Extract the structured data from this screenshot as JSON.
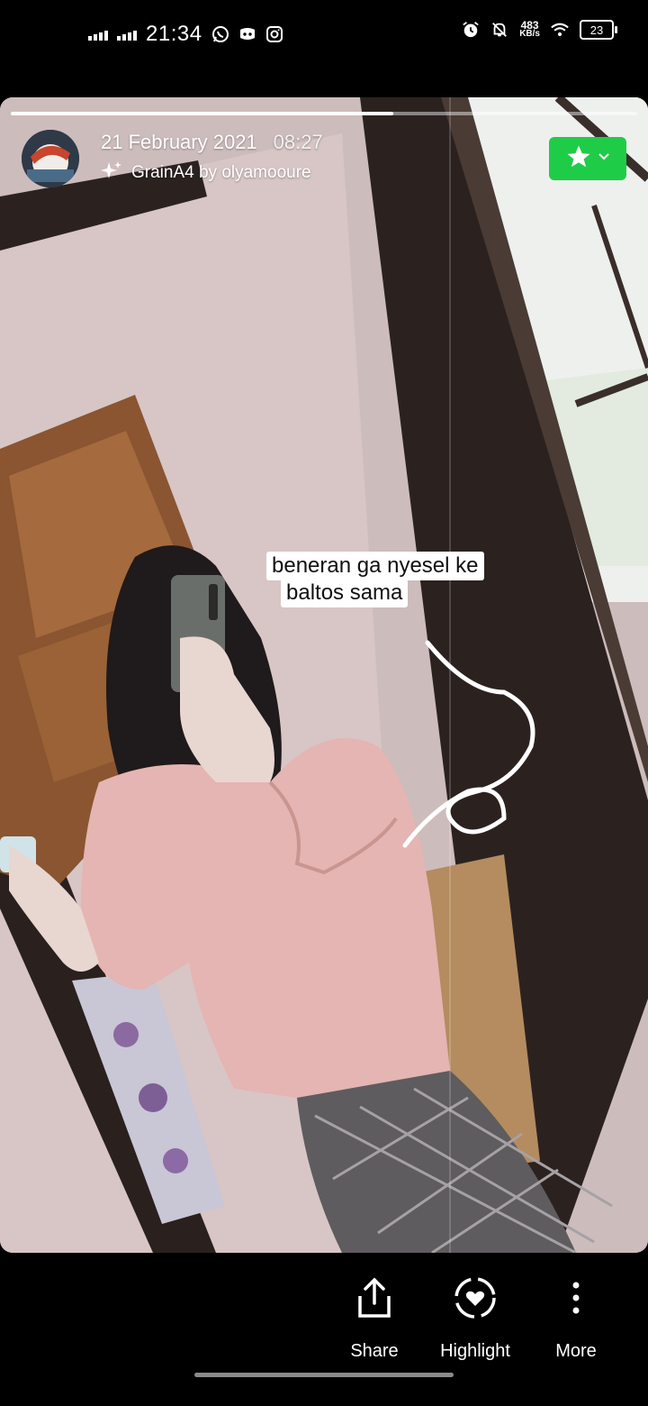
{
  "status_bar": {
    "time": "21:34",
    "net_speed_value": "483",
    "net_speed_unit": "KB/s",
    "battery": "23",
    "icons": [
      "signal-icon",
      "whatsapp-icon",
      "discord-icon",
      "instagram-icon",
      "alarm-icon",
      "mute-icon",
      "wifi-icon",
      "battery-icon"
    ]
  },
  "story": {
    "progress": 0.61,
    "date": "21 February 2021",
    "time": "08:27",
    "filter_credit": "GrainA4 by olyamooure",
    "caption_line1": "beneran ga nyesel ke",
    "caption_line2": "baltos sama",
    "favorite_icon": "star-icon",
    "accent_color": "#1fcc48"
  },
  "actions": {
    "share": "Share",
    "highlight": "Highlight",
    "more": "More"
  }
}
